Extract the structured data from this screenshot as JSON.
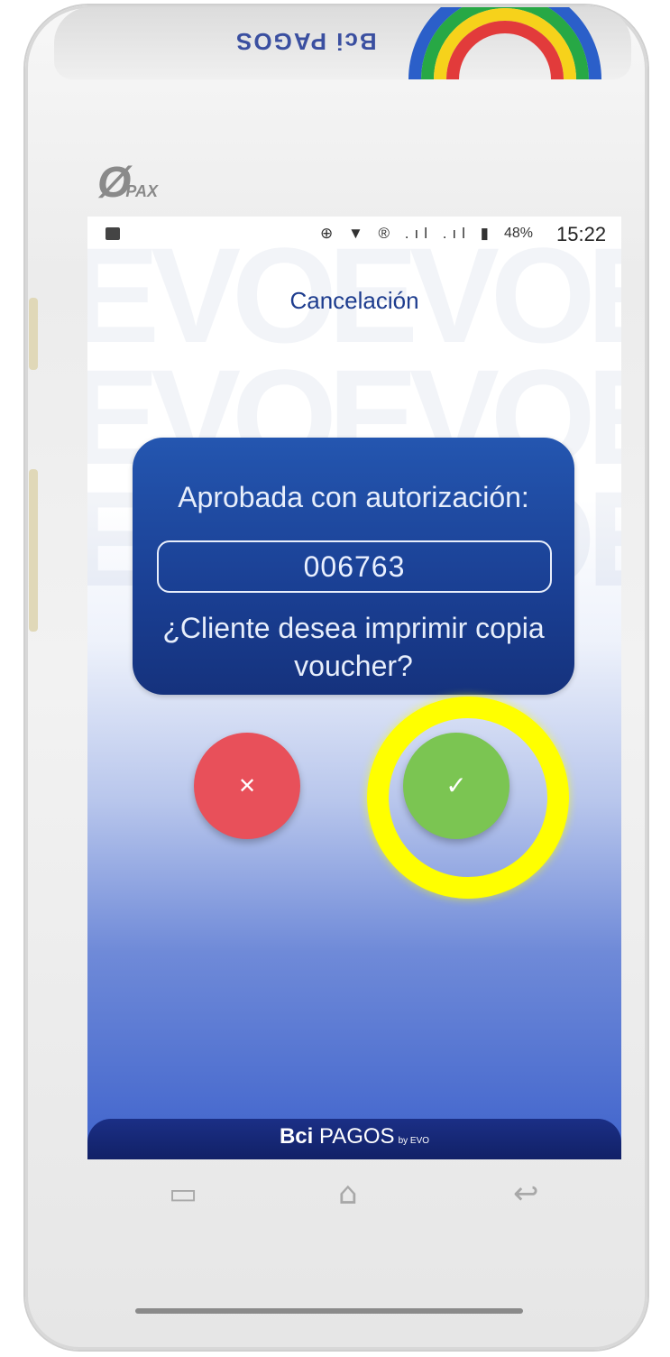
{
  "device": {
    "brand_top": "Bci PAGOS",
    "maker_logo": "PAX"
  },
  "statusbar": {
    "left_icon": "image-icon",
    "icons": "⊕ ▼ ®  .ıl .ıl ▮",
    "battery": "48%",
    "time": "15:22"
  },
  "screen": {
    "title": "Cancelación",
    "watermark": "EVOEVOE"
  },
  "dialog": {
    "message": "Aprobada con autorización:",
    "auth_code": "006763",
    "question": "¿Cliente desea imprimir copia voucher?"
  },
  "buttons": {
    "cancel_symbol": "✕",
    "confirm_symbol": "✓"
  },
  "footer": {
    "brand_bold": "Bci",
    "brand_rest": " PAGOS",
    "brand_sub": "by EVO"
  },
  "navbar": {
    "recent": "▭",
    "home": "⌂",
    "back": "↩"
  },
  "colors": {
    "title_blue": "#1d3c8e",
    "dialog_blue": "#1a3f93",
    "cancel_red": "#e8505a",
    "confirm_green": "#7bc552",
    "highlight_yellow": "#ffff00"
  }
}
